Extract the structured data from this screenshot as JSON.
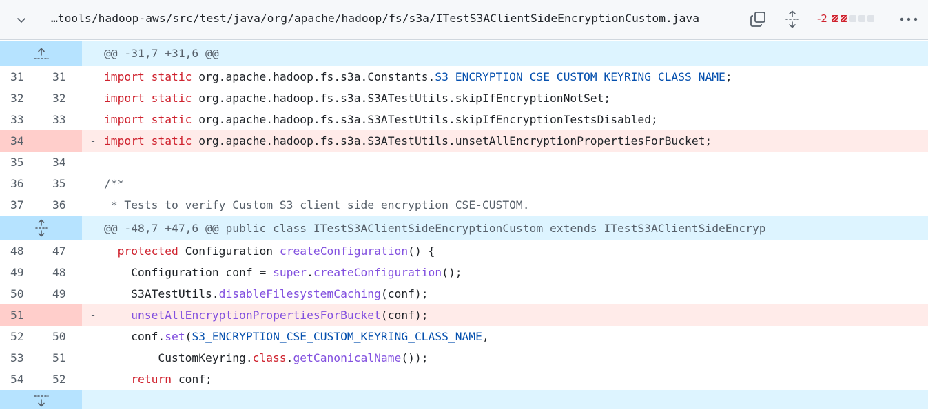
{
  "header": {
    "file_path": "…tools/hadoop-aws/src/test/java/org/apache/hadoop/fs/s3a/ITestS3AClientSideEncryptionCustom.java",
    "diffstat_text": "-2",
    "diffstat_boxes": [
      "deleted",
      "deleted",
      "neutral",
      "neutral",
      "neutral"
    ]
  },
  "hunks": [
    {
      "header": "@@ -31,7 +31,6 @@",
      "lines": [
        {
          "old": "31",
          "new": "31",
          "marker": "",
          "type": "ctx"
        },
        {
          "old": "32",
          "new": "32",
          "marker": "",
          "type": "ctx"
        },
        {
          "old": "33",
          "new": "33",
          "marker": "",
          "type": "ctx"
        },
        {
          "old": "34",
          "new": "",
          "marker": "-",
          "type": "del"
        },
        {
          "old": "35",
          "new": "34",
          "marker": "",
          "type": "ctx"
        },
        {
          "old": "36",
          "new": "35",
          "marker": "",
          "type": "ctx"
        },
        {
          "old": "37",
          "new": "36",
          "marker": "",
          "type": "ctx"
        }
      ]
    },
    {
      "header": "@@ -48,7 +47,6 @@ public class ITestS3AClientSideEncryptionCustom extends ITestS3AClientSideEncryp",
      "lines": [
        {
          "old": "48",
          "new": "47",
          "marker": "",
          "type": "ctx"
        },
        {
          "old": "49",
          "new": "48",
          "marker": "",
          "type": "ctx"
        },
        {
          "old": "50",
          "new": "49",
          "marker": "",
          "type": "ctx"
        },
        {
          "old": "51",
          "new": "",
          "marker": "-",
          "type": "del"
        },
        {
          "old": "52",
          "new": "50",
          "marker": "",
          "type": "ctx"
        },
        {
          "old": "53",
          "new": "51",
          "marker": "",
          "type": "ctx"
        },
        {
          "old": "54",
          "new": "52",
          "marker": "",
          "type": "ctx"
        }
      ]
    }
  ],
  "code": {
    "l31_a": "import",
    "l31_b": " ",
    "l31_c": "static",
    "l31_d": " org.apache.hadoop.fs.s3a.Constants.",
    "l31_e": "S3_ENCRYPTION_CSE_CUSTOM_KEYRING_CLASS_NAME",
    "l31_f": ";",
    "l32_a": "import",
    "l32_c": "static",
    "l32_d": " org.apache.hadoop.fs.s3a.S3ATestUtils.skipIfEncryptionNotSet;",
    "l33_a": "import",
    "l33_c": "static",
    "l33_d": " org.apache.hadoop.fs.s3a.S3ATestUtils.skipIfEncryptionTestsDisabled;",
    "l34_a": "import",
    "l34_c": "static",
    "l34_d": " org.apache.hadoop.fs.s3a.S3ATestUtils.unsetAllEncryptionPropertiesForBucket;",
    "l36": "/**",
    "l37": " * Tests to verify Custom S3 client side encryption CSE-CUSTOM.",
    "l48_a": "  ",
    "l48_b": "protected",
    "l48_c": " Configuration ",
    "l48_d": "createConfiguration",
    "l48_e": "() {",
    "l49_a": "    Configuration conf = ",
    "l49_b": "super",
    "l49_c": ".",
    "l49_d": "createConfiguration",
    "l49_e": "();",
    "l50_a": "    S3ATestUtils.",
    "l50_b": "disableFilesystemCaching",
    "l50_c": "(conf);",
    "l51_a": "    ",
    "l51_b": "unsetAllEncryptionPropertiesForBucket",
    "l51_c": "(conf);",
    "l52_a": "    conf.",
    "l52_b": "set",
    "l52_c": "(",
    "l52_d": "S3_ENCRYPTION_CSE_CUSTOM_KEYRING_CLASS_NAME",
    "l52_e": ",",
    "l53_a": "        CustomKeyring.",
    "l53_b": "class",
    "l53_c": ".",
    "l53_d": "getCanonicalName",
    "l53_e": "());",
    "l54_a": "    ",
    "l54_b": "return",
    "l54_c": " conf;"
  },
  "colors": {
    "hunk_bg": "#ddf4ff",
    "expander_bg": "#b6e3ff",
    "deleted_bg": "#ffebe9",
    "deleted_num_bg": "#ffcecb",
    "keyword": "#cf222e",
    "constant": "#0550ae",
    "function": "#8250df"
  },
  "icons": {
    "collapse": "chevron-down-icon",
    "copy": "copy-icon",
    "expand_all": "unfold-icon",
    "more": "kebab-horizontal-icon",
    "expand_up": "fold-up-icon",
    "expand_both": "unfold-icon",
    "expand_down": "fold-down-icon"
  }
}
